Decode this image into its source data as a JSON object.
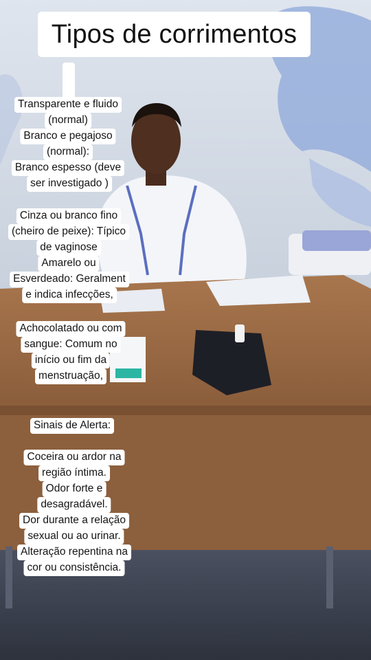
{
  "title": "Tipos de corrimentos",
  "block1": [
    "Transparente e fluido",
    "(normal)",
    "Branco e pegajoso",
    "(normal):",
    "Branco espesso (deve",
    "ser investigado )"
  ],
  "block2": [
    "Cinza ou branco fino",
    "(cheiro de peixe): Típico",
    "de vaginose",
    "Amarelo ou",
    "Esverdeado: Geralment",
    "e indica infecções,"
  ],
  "block3": [
    "Achocolatado ou com",
    "sangue: Comum no",
    "início ou fim da",
    "menstruação,"
  ],
  "block4": [
    "Sinais de Alerta:"
  ],
  "block5": [
    "Coceira ou ardor na",
    "região íntima.",
    "Odor forte e",
    "desagradável.",
    "Dor durante a relação",
    "sexual ou ao urinar.",
    "Alteração repentina na",
    "cor ou consistência."
  ],
  "colors": {
    "wall": "#d4dce6",
    "wall_stain": "#8aa4d6",
    "table": "#9a6a44",
    "floor": "#3b4252",
    "coat": "#f2f4f8",
    "caption_bg": "#ffffff"
  }
}
